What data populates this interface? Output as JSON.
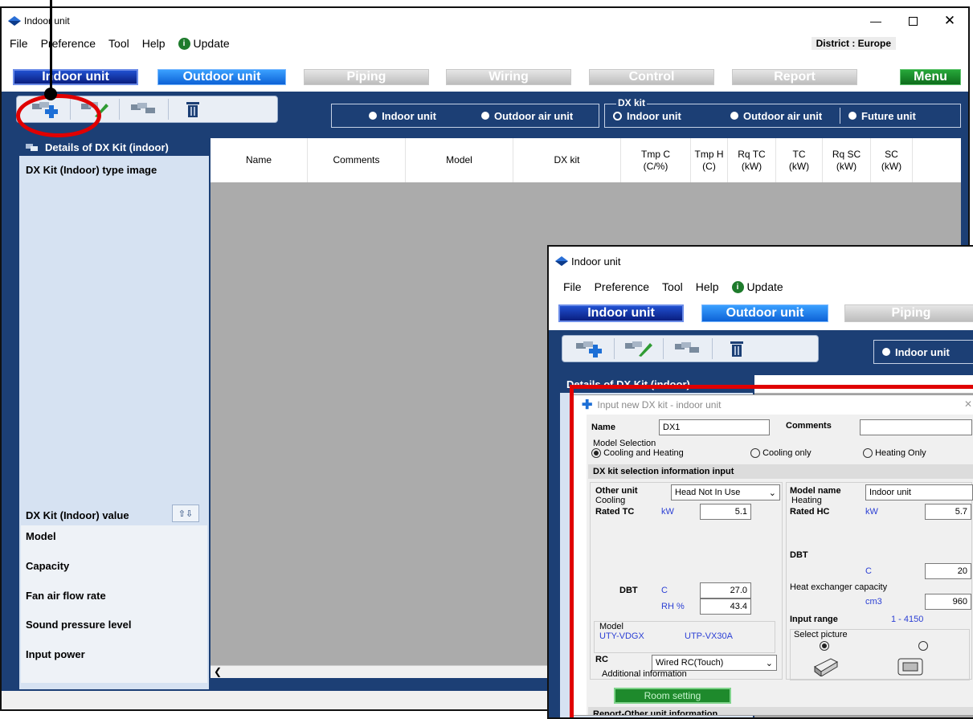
{
  "main_window": {
    "title": "Indoor unit",
    "menu": [
      "File",
      "Preference",
      "Tool",
      "Help"
    ],
    "update_label": "Update",
    "district": "District : Europe",
    "tabs": {
      "indoor": "Indoor unit",
      "outdoor": "Outdoor unit",
      "piping": "Piping",
      "wiring": "Wiring",
      "control": "Control",
      "report": "Report",
      "menu": "Menu"
    },
    "radio_indoor": "Indoor unit",
    "radio_outdoor_air": "Outdoor air unit",
    "dx_kit_label": "DX kit",
    "dx_indoor": "Indoor unit",
    "dx_outdoor_air": "Outdoor air unit",
    "future_unit": "Future unit",
    "details_header": "Details of DX Kit (indoor)",
    "type_image_label": "DX Kit (Indoor) type image",
    "value_label": "DX Kit (Indoor) value",
    "value_rows": [
      "Model",
      "Capacity",
      "Fan air flow rate",
      "Sound pressure level",
      "Input power"
    ],
    "columns": [
      {
        "label": "Name",
        "sub": ""
      },
      {
        "label": "Comments",
        "sub": ""
      },
      {
        "label": "Model",
        "sub": ""
      },
      {
        "label": "DX kit",
        "sub": ""
      },
      {
        "label": "Tmp C",
        "sub": "(C/%)"
      },
      {
        "label": "Tmp H",
        "sub": "(C)"
      },
      {
        "label": "Rq TC",
        "sub": "(kW)"
      },
      {
        "label": "TC",
        "sub": "(kW)"
      },
      {
        "label": "Rq SC",
        "sub": "(kW)"
      },
      {
        "label": "SC",
        "sub": "(kW)"
      }
    ]
  },
  "second_window": {
    "title": "Indoor unit",
    "menu": [
      "File",
      "Preference",
      "Tool",
      "Help"
    ],
    "update_label": "Update",
    "tabs": {
      "indoor": "Indoor unit",
      "outdoor": "Outdoor unit",
      "piping": "Piping"
    },
    "radio_indoor": "Indoor unit",
    "details_header_partial": "Details of DX Kit (indoor)"
  },
  "dialog": {
    "title": "Input new DX kit - indoor unit",
    "name_label": "Name",
    "name_value": "DX1",
    "comments_label": "Comments",
    "comments_value": "",
    "model_selection_label": "Model Selection",
    "mode_options": [
      "Cooling and Heating",
      "Cooling only",
      "Heating Only"
    ],
    "selection_section": "DX kit selection information input",
    "other_unit_label": "Other unit",
    "other_unit_value": "Head Not In Use",
    "model_name_label": "Model name",
    "model_name_value": "Indoor unit",
    "cooling_label": "Cooling",
    "rated_tc_label": "Rated TC",
    "kw_unit": "kW",
    "rated_tc_value": "5.1",
    "heating_label": "Heating",
    "rated_hc_label": "Rated HC",
    "rated_hc_value": "5.7",
    "dbt_label": "DBT",
    "c_unit": "C",
    "dbt_cool_value": "27.0",
    "rh_unit": "RH %",
    "rh_value": "43.4",
    "dbt_heat_value": "20",
    "hex_label": "Heat exchanger capacity",
    "cm3_unit": "cm3",
    "hex_value": "960",
    "model_group_label": "Model",
    "model_a": "UTY-VDGX",
    "model_b": "UTP-VX30A",
    "input_range_label": "Input range",
    "input_range_value": "1 - 4150",
    "select_picture_label": "Select picture",
    "rc_label": "RC",
    "rc_value": "Wired RC(Touch)",
    "additional_info_label": "Additional information",
    "room_setting_label": "Room setting",
    "report_section": "Report-Other unit information"
  }
}
